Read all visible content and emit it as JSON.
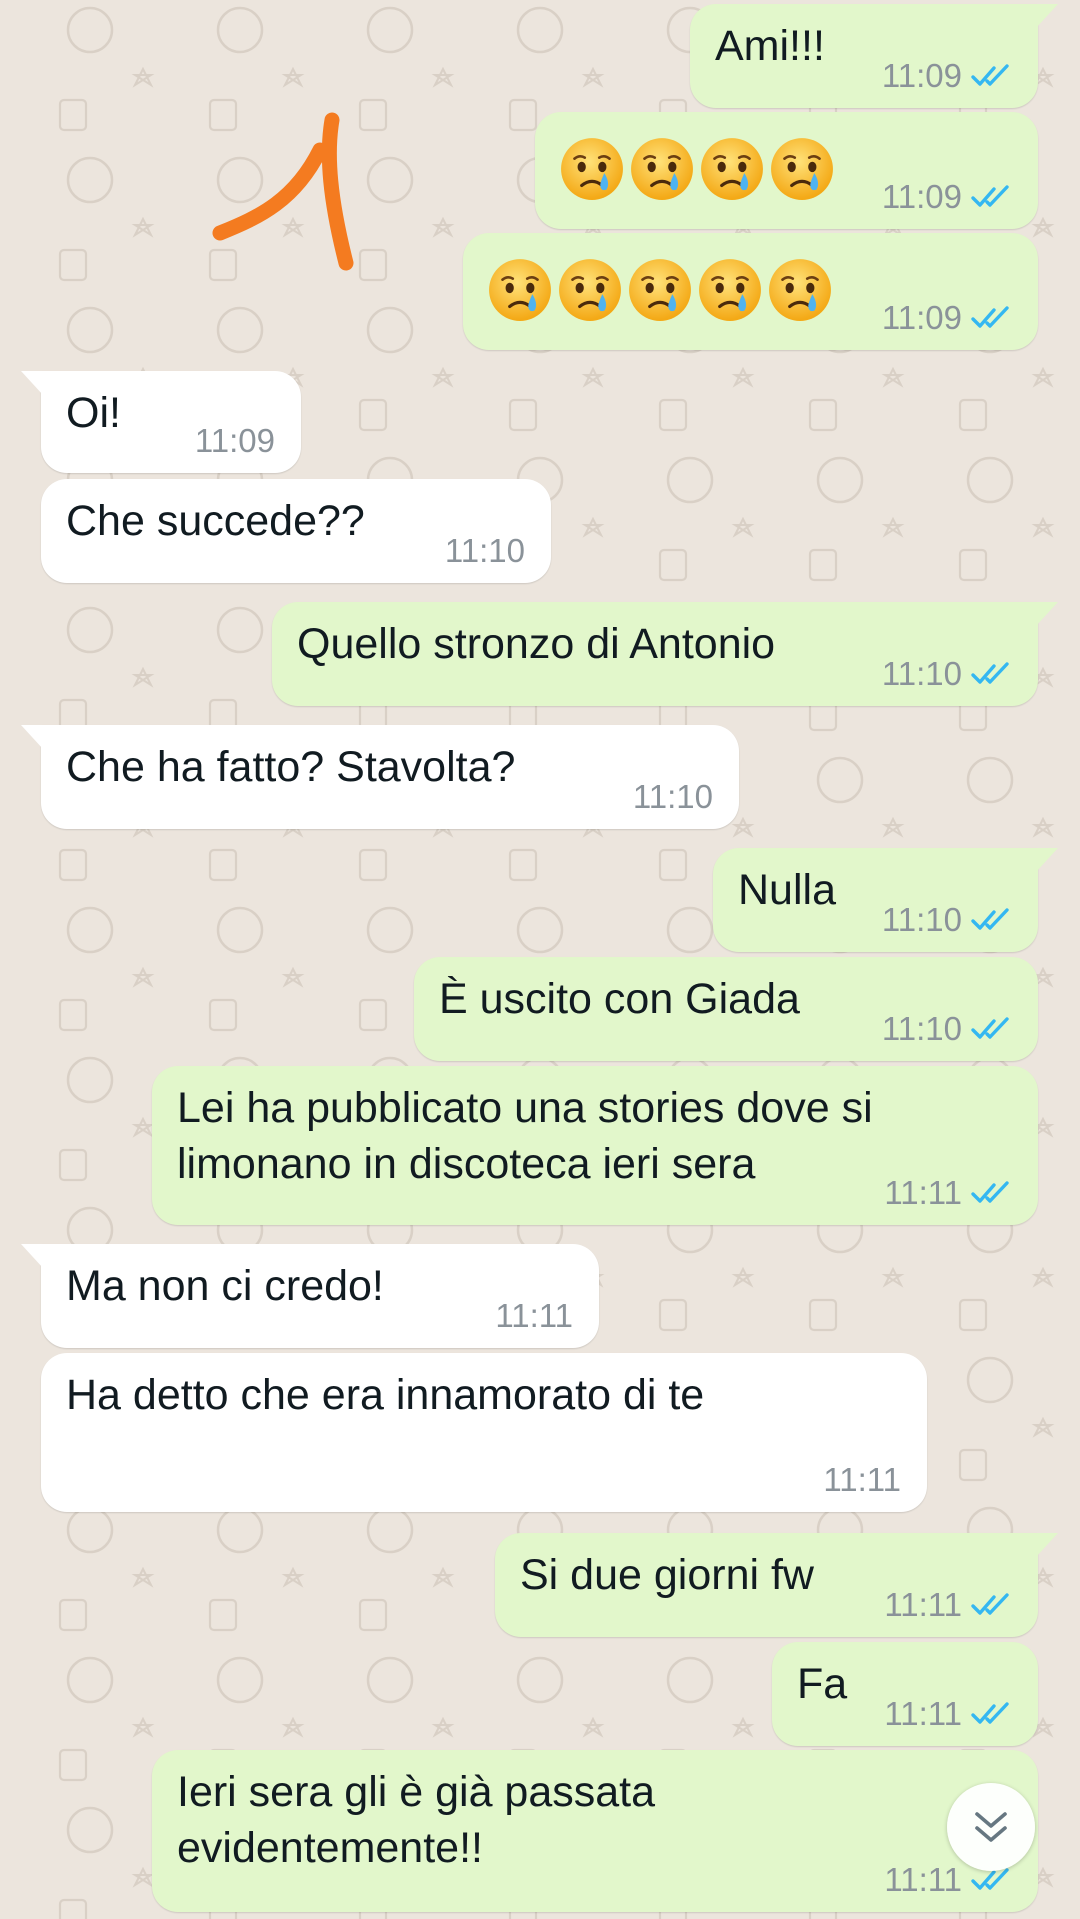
{
  "colors": {
    "wallpaper": "#ece5dd",
    "outgoing_bubble": "#e2f7cb",
    "incoming_bubble": "#ffffff",
    "read_ticks": "#34b7f1",
    "annotation_stroke": "#f47b20"
  },
  "messages": [
    {
      "direction": "outgoing",
      "type": "text",
      "text": "Ami!!!",
      "time": "11:09",
      "status": "read"
    },
    {
      "direction": "outgoing",
      "type": "emoji",
      "emoji_count": 4,
      "emoji_icon": "crying-face-icon",
      "time": "11:09",
      "status": "read"
    },
    {
      "direction": "outgoing",
      "type": "emoji",
      "emoji_count": 5,
      "emoji_icon": "crying-face-icon",
      "time": "11:09",
      "status": "read"
    },
    {
      "direction": "incoming",
      "type": "text",
      "text": "Oi!",
      "time": "11:09"
    },
    {
      "direction": "incoming",
      "type": "text",
      "text": "Che succede??",
      "time": "11:10"
    },
    {
      "direction": "outgoing",
      "type": "text",
      "text": "Quello stronzo di Antonio",
      "time": "11:10",
      "status": "read"
    },
    {
      "direction": "incoming",
      "type": "text",
      "text": "Che ha fatto? Stavolta?",
      "time": "11:10"
    },
    {
      "direction": "outgoing",
      "type": "text",
      "text": "Nulla",
      "time": "11:10",
      "status": "read"
    },
    {
      "direction": "outgoing",
      "type": "text",
      "text": "È uscito con Giada",
      "time": "11:10",
      "status": "read"
    },
    {
      "direction": "outgoing",
      "type": "text",
      "text": "Lei ha pubblicato una stories dove si\nlimonano in discoteca ieri sera",
      "time": "11:11",
      "status": "read"
    },
    {
      "direction": "incoming",
      "type": "text",
      "text": "Ma non ci credo!",
      "time": "11:11"
    },
    {
      "direction": "incoming",
      "type": "text",
      "text": "Ha detto che era innamorato di te",
      "time": "11:11"
    },
    {
      "direction": "outgoing",
      "type": "text",
      "text": "Si due giorni fw",
      "time": "11:11",
      "status": "read"
    },
    {
      "direction": "outgoing",
      "type": "text",
      "text": "Fa",
      "time": "11:11",
      "status": "read"
    },
    {
      "direction": "outgoing",
      "type": "text",
      "text": "Ieri sera gli è già passata\nevidentemente!!",
      "time": "11:11",
      "status": "read"
    }
  ],
  "controls": {
    "scroll_down_icon": "double-chevron-down-icon"
  },
  "annotation": {
    "icon": "hand-drawn-arrow-icon"
  }
}
